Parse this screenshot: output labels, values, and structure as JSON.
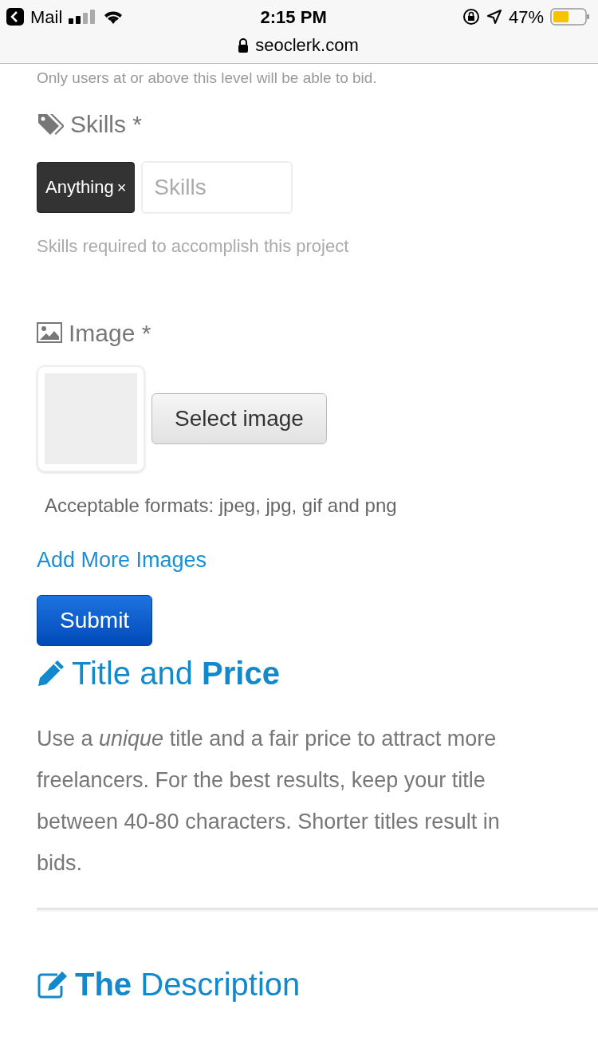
{
  "status_bar": {
    "back_label": "Mail",
    "time": "2:15 PM",
    "battery_text": "47%",
    "url": "seoclerk.com"
  },
  "level_note": "Only users at or above this level will be able to bid.",
  "skills": {
    "label": "Skills *",
    "tags": [
      {
        "text": "Anything",
        "remove": "×"
      }
    ],
    "placeholder": "Skills",
    "help": "Skills required to accomplish this project"
  },
  "image": {
    "label": "Image *",
    "button": "Select image",
    "help": "Acceptable formats: jpeg, jpg, gif and png",
    "add_link": "Add More Images"
  },
  "submit": "Submit",
  "sections": [
    {
      "kind": "title",
      "heading": "Title and **Price**",
      "text": "Use a *unique* title and a fair price to attract more\nfreelancers. For the best results, keep your title\nbetween 40-80 characters. Shorter titles result in\nbids."
    },
    {
      "kind": "description",
      "heading": "**The** Description"
    }
  ]
}
